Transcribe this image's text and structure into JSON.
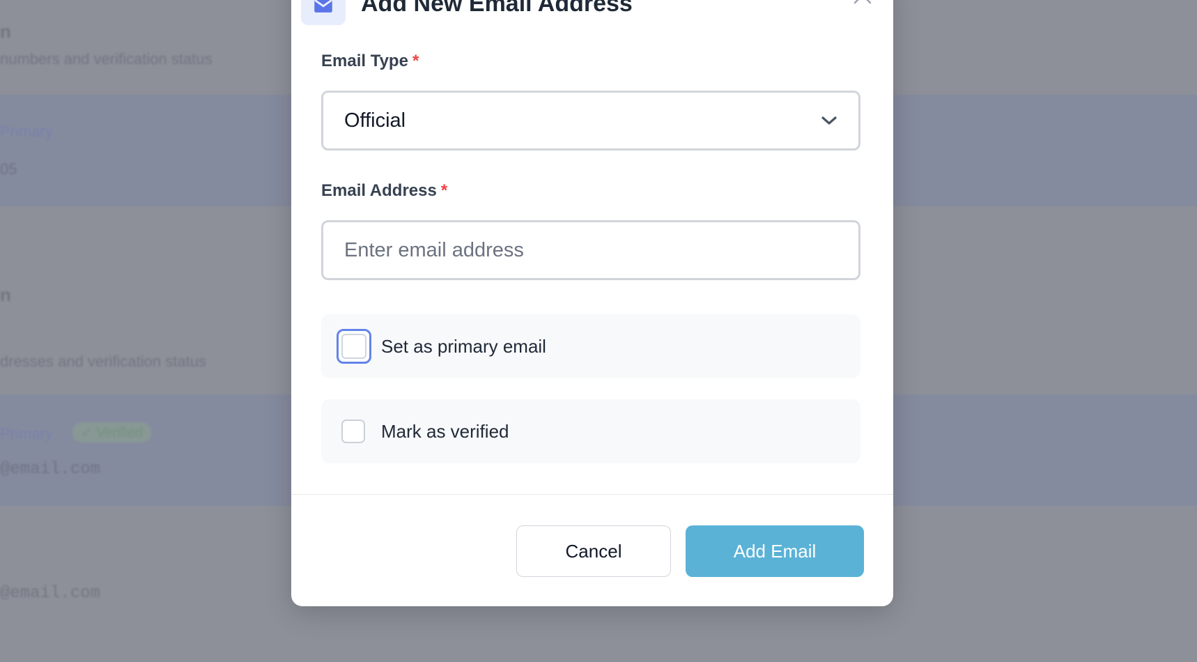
{
  "background": {
    "heading_1": "n",
    "sub_1": "numbers and verification status",
    "link_1": "Primary",
    "value_1": "05",
    "heading_2": "n",
    "sub_2": "dresses and verification status",
    "link_2": "Primary",
    "badge_2": "✓ Verified",
    "value_2": "@email.com",
    "value_3": "@email.com"
  },
  "modal": {
    "title": "Add New Email Address",
    "icon": "envelope-icon",
    "close_icon": "close-icon",
    "email_type": {
      "label": "Email Type",
      "required_mark": "*",
      "value": "Official"
    },
    "email_address": {
      "label": "Email Address",
      "required_mark": "*",
      "value": "",
      "placeholder": "Enter email address"
    },
    "primary_checkbox": {
      "label": "Set as primary email",
      "checked": false
    },
    "verified_checkbox": {
      "label": "Mark as verified",
      "checked": false
    },
    "cancel_label": "Cancel",
    "submit_label": "Add Email"
  },
  "colors": {
    "accent": "#5ab2d6",
    "focus_ring": "#6384e9",
    "required": "#ef4444",
    "overlay": "#8d9099"
  }
}
